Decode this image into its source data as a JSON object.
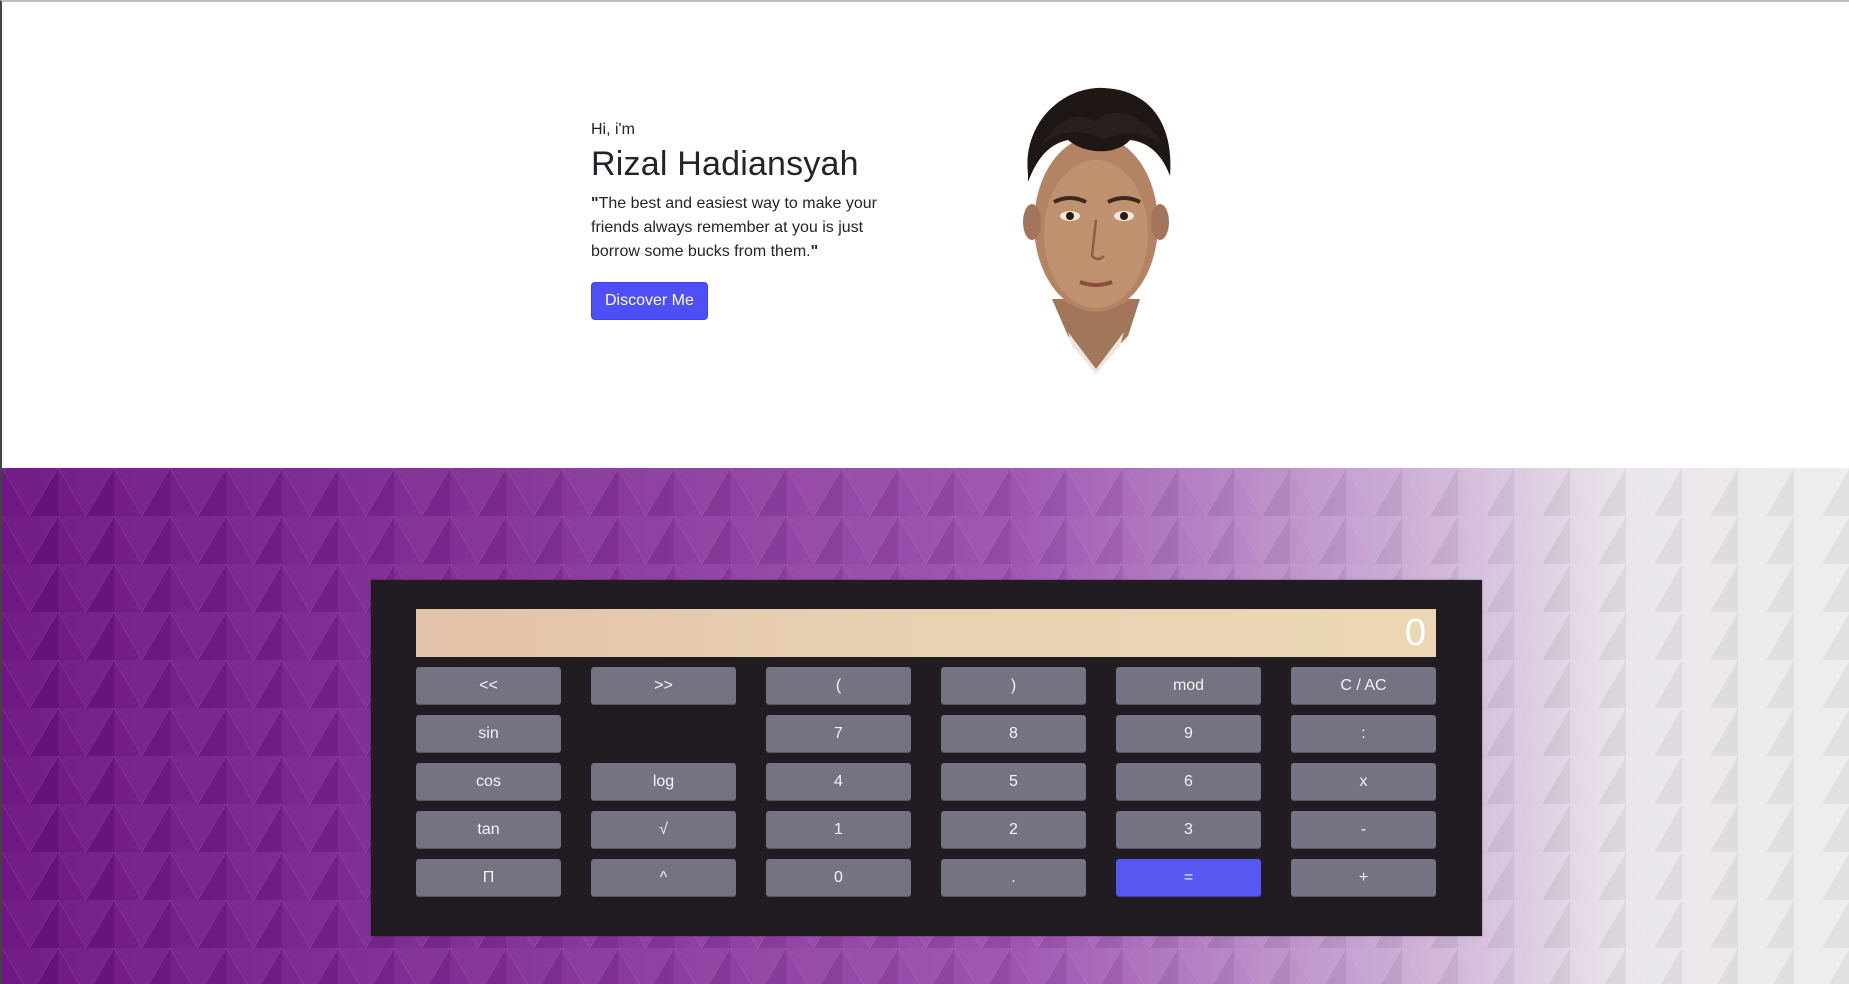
{
  "hero": {
    "greeting": "Hi, i'm",
    "name": "Rizal Hadiansyah",
    "quote_open": "\"",
    "quote_text": "The best and easiest way to make your friends always remember at you is just borrow some bucks from them.",
    "quote_close": "\"",
    "button_label": "Discover Me"
  },
  "calculator": {
    "display_value": "0",
    "rows": [
      [
        "<<",
        ">>",
        "(",
        ")",
        "mod",
        "C / AC"
      ],
      [
        "sin",
        "",
        "7",
        "8",
        "9",
        ":"
      ],
      [
        "cos",
        "log",
        "4",
        "5",
        "6",
        "x"
      ],
      [
        "tan",
        "√",
        "1",
        "2",
        "3",
        "-"
      ],
      [
        "Π",
        "^",
        "0",
        ".",
        "=",
        "+"
      ]
    ]
  },
  "colors": {
    "accent": "#4f4ff7",
    "key": "#757382",
    "equals_key": "#5757f2",
    "calculator_body": "#211c22"
  }
}
